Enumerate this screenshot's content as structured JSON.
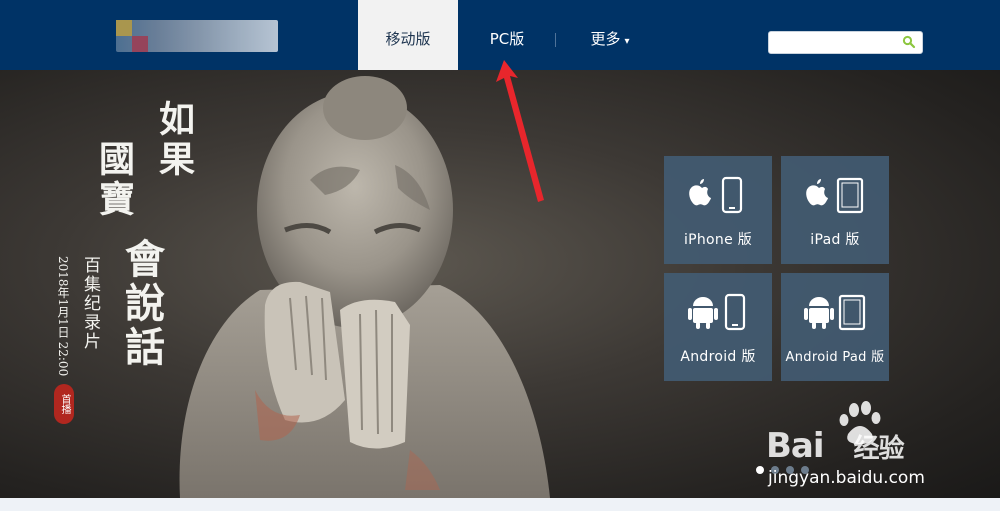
{
  "header": {
    "logo_alt": "site-logo",
    "tabs": [
      {
        "label": "移动版",
        "active": true
      },
      {
        "label": "PC版",
        "active": false
      },
      {
        "label": "更多",
        "active": false
      }
    ],
    "more_caret": "▾",
    "search": {
      "value": "",
      "placeholder": ""
    }
  },
  "hero": {
    "title_chars": [
      "如果",
      "國寶",
      "會說話"
    ],
    "subtitle": "百集纪录片",
    "air_date": "2018年1月1日 22:00",
    "seal_text": "首播",
    "slider_dots": [
      true,
      false,
      false,
      false
    ]
  },
  "download_tiles": [
    {
      "label": "iPhone 版",
      "os_icon": "apple-icon",
      "device_icon": "phone-icon"
    },
    {
      "label": "iPad 版",
      "os_icon": "apple-icon",
      "device_icon": "tablet-icon"
    },
    {
      "label": "Android 版",
      "os_icon": "android-icon",
      "device_icon": "phone-icon"
    },
    {
      "label": "Android Pad 版",
      "os_icon": "android-icon",
      "device_icon": "tablet-icon"
    }
  ],
  "watermark": {
    "brand": "Bai",
    "brand_suffix": "经验",
    "url": "jingyan.baidu.com"
  },
  "colors": {
    "header_bg": "#003366",
    "active_tab_bg": "#f2f2f2",
    "tile_bg": "#425b72",
    "search_icon": "#8cc63f",
    "annotation_arrow": "#e8262c"
  }
}
